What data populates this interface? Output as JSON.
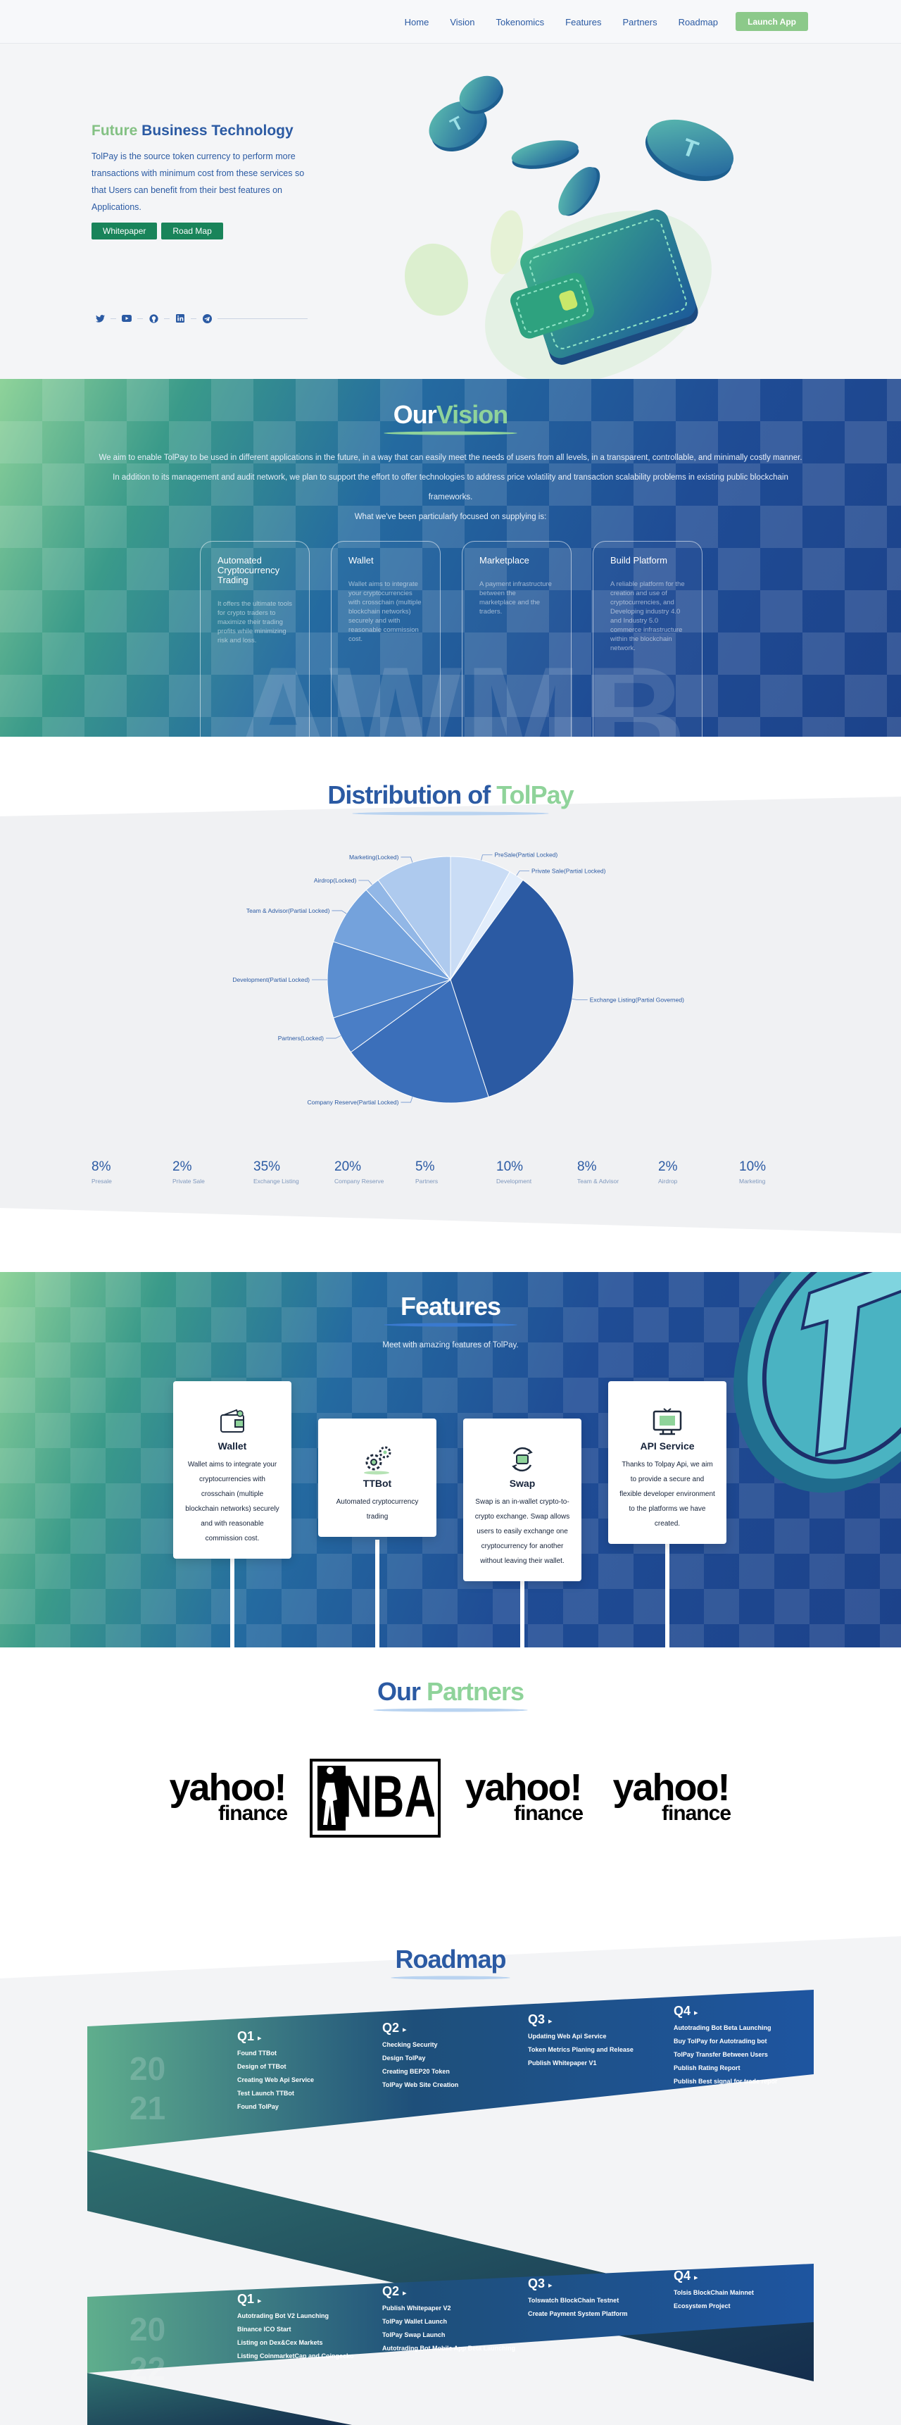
{
  "nav": {
    "links": [
      "Home",
      "Vision",
      "Tokenomics",
      "Features",
      "Partners",
      "Roadmap"
    ],
    "launch": "Launch App"
  },
  "hero": {
    "title_a": "Future",
    "title_b": "Business Technology",
    "desc": "TolPay is the source token currency to perform more transactions with minimum cost from these services so that Users can benefit from their best features on Applications.",
    "btn_whitepaper": "Whitepaper",
    "btn_roadmap": "Road Map",
    "socials": [
      "twitter-icon",
      "youtube-icon",
      "github-icon",
      "linkedin-icon",
      "telegram-icon"
    ]
  },
  "vision": {
    "title_a": "Our",
    "title_b": "Vision",
    "intro": "We aim to enable TolPay to be used in different applications in the future, in a way that can easily meet the needs of users from all levels, in a transparent, controllable, and minimally costly manner. In addition to its management and audit network, we plan to support the effort to offer technologies to address price volatility and transaction scalability problems in existing public blockchain frameworks.",
    "sub": "What we've been particularly focused on supplying is:",
    "cards": [
      {
        "title": "Automated Cryptocurrency Trading",
        "text": "It offers the ultimate tools for crypto traders to maximize their trading profits while minimizing risk and loss."
      },
      {
        "title": "Wallet",
        "text": "Wallet aims to integrate your cryptocurrencies with crosschain (multiple blockchain networks) securely and with reasonable commission cost."
      },
      {
        "title": "Marketplace",
        "text": "A payment infrastructure between the marketplace and the traders."
      },
      {
        "title": "Build Platform",
        "text": "A reliable platform for the creation and use of cryptocurrencies, and Developing industry 4.0 and Industry 5.0 commerce infrastructure within the blockchain network."
      }
    ],
    "letters": "AWMB"
  },
  "distribution": {
    "title_a": "Distribution of",
    "title_b": "TolPay",
    "stats": [
      {
        "pct": "8%",
        "label": "Presale"
      },
      {
        "pct": "2%",
        "label": "Private Sale"
      },
      {
        "pct": "35%",
        "label": "Exchange Listing"
      },
      {
        "pct": "20%",
        "label": "Company Reserve"
      },
      {
        "pct": "5%",
        "label": "Partners"
      },
      {
        "pct": "10%",
        "label": "Development"
      },
      {
        "pct": "8%",
        "label": "Team & Advisor"
      },
      {
        "pct": "2%",
        "label": "Airdrop"
      },
      {
        "pct": "10%",
        "label": "Marketing"
      }
    ]
  },
  "chart_data": {
    "type": "pie",
    "slices": [
      {
        "label": "PreSale(Partial Locked)",
        "value": 8,
        "color": "#c9dcf5"
      },
      {
        "label": "Private Sale(Partial Locked)",
        "value": 2,
        "color": "#e2edfb"
      },
      {
        "label": "Exchange Listing(Partial Governed)",
        "value": 35,
        "color": "#2b5aa3"
      },
      {
        "label": "Company Reserve(Partial Locked)",
        "value": 20,
        "color": "#3b6fba"
      },
      {
        "label": "Partners(Locked)",
        "value": 5,
        "color": "#4a7ec6"
      },
      {
        "label": "Development(Partial Locked)",
        "value": 10,
        "color": "#5b8ed0"
      },
      {
        "label": "Team & Advisor(Partial Locked)",
        "value": 8,
        "color": "#74a2dc"
      },
      {
        "label": "Airdrop(Locked)",
        "value": 2,
        "color": "#92b7e6"
      },
      {
        "label": "Marketing(Locked)",
        "value": 10,
        "color": "#aecaee"
      }
    ]
  },
  "features": {
    "title": "Features",
    "sub": "Meet with amazing features of TolPay.",
    "cards": [
      {
        "title": "Wallet",
        "text": "Wallet aims to integrate your cryptocurrencies with crosschain (multiple blockchain networks) securely and with reasonable commission cost.",
        "icon": "wallet-icon"
      },
      {
        "title": "TTBot",
        "text": "Automated cryptocurrency trading",
        "icon": "gears-icon"
      },
      {
        "title": "Swap",
        "text": "Swap is an in-wallet crypto-to-crypto exchange. Swap allows users to easily exchange one cryptocurrency for another without leaving their wallet.",
        "icon": "swap-icon"
      },
      {
        "title": "API Service",
        "text": "Thanks to Tolpay Api, we aim to provide a secure and flexible developer environment to the platforms we have created.",
        "icon": "api-monitor-icon"
      }
    ]
  },
  "partners": {
    "title_a": "Our",
    "title_b": "Partners",
    "logos": [
      {
        "type": "yahoo",
        "l1": "yahoo!",
        "l2": "finance"
      },
      {
        "type": "nba",
        "text": "NBA"
      },
      {
        "type": "yahoo",
        "l1": "yahoo!",
        "l2": "finance"
      },
      {
        "type": "yahoo",
        "l1": "yahoo!",
        "l2": "finance"
      }
    ]
  },
  "roadmap": {
    "title": "Roadmap",
    "year1": [
      "20",
      "21"
    ],
    "year2": [
      "20",
      "22"
    ],
    "q2021": [
      {
        "q": "Q1",
        "items": [
          "Found TTBot",
          "Design of TTBot",
          "Creating Web Api Service",
          "Test Launch TTBot",
          "Found TolPay"
        ]
      },
      {
        "q": "Q2",
        "items": [
          "Checking Security",
          "Design TolPay",
          "Creating BEP20 Token",
          "TolPay Web Site Creation"
        ]
      },
      {
        "q": "Q3",
        "items": [
          "Updating Web Api Service",
          "Token Metrics Planing and Release",
          "Publish Whitepaper V1"
        ]
      },
      {
        "q": "Q4",
        "items": [
          "Autotrading Bot Beta Launching",
          "Buy TolPay for Autotrading bot",
          "TolPay Transfer Between Users",
          "Publish Rating Report",
          "Publish Best signal for trade repor"
        ]
      }
    ],
    "q2022": [
      {
        "q": "Q1",
        "items": [
          "Autotrading Bot V2 Launching",
          "Binance ICO Start",
          "Listing on Dex&Cex Markets",
          "Listing CoinmarketCap and Coingecko"
        ]
      },
      {
        "q": "Q2",
        "items": [
          "Publish Whitepaper V2",
          "TolPay Wallet Launch",
          "TolPay Swap Launch",
          "Autotrading Bot Mobile App Beta Launching"
        ]
      },
      {
        "q": "Q3",
        "items": [
          "Tolswatch BlockChain Testnet",
          "Create Payment System Platform"
        ]
      },
      {
        "q": "Q4",
        "items": [
          "Tolsis BlockChain Mainnet",
          "Ecosystem Project"
        ]
      }
    ]
  }
}
